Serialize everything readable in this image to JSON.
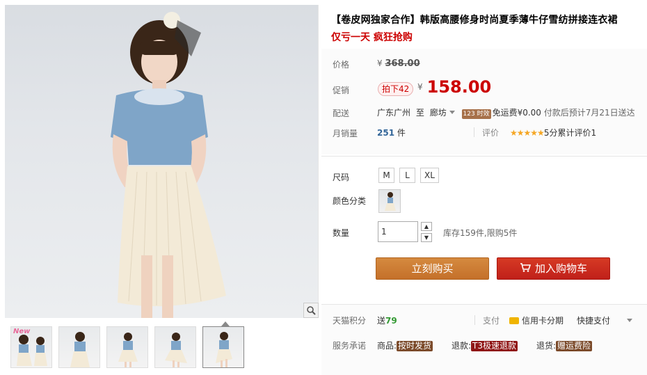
{
  "product": {
    "title": "【卷皮网独家合作】韩版高腰修身时尚夏季薄牛仔雪纺拼接连衣裙",
    "subtitle": "仅亏一天 疯狂抢购"
  },
  "price": {
    "label": "价格",
    "original_currency": "¥",
    "original": "368.00",
    "promo_label": "促销",
    "promo_tag": "拍下42",
    "promo_currency": "¥",
    "promo": "158.00"
  },
  "shipping": {
    "label": "配送",
    "from": "广东广州",
    "to_word": "至",
    "to": "廊坊",
    "badge": "123 时效",
    "free_text": "免运费¥0.00",
    "eta": "付款后预计7月21日送达"
  },
  "sales": {
    "label": "月销量",
    "count": "251",
    "unit": "件",
    "review_label": "评价",
    "stars": "★★★★★",
    "review_text": "5分累计评价1"
  },
  "size": {
    "label": "尺码",
    "options": [
      "M",
      "L",
      "XL"
    ]
  },
  "color": {
    "label": "颜色分类"
  },
  "quantity": {
    "label": "数量",
    "value": "1",
    "up": "▲",
    "down": "▼",
    "stock_text": "库存159件,限购5件"
  },
  "actions": {
    "buy_now": "立刻购买",
    "add_cart": "加入购物车"
  },
  "points": {
    "label": "天猫积分",
    "text_prefix": "送",
    "value": "79"
  },
  "payment": {
    "label": "支付",
    "credit": "信用卡分期",
    "quick": "快捷支付"
  },
  "service": {
    "label": "服务承诺",
    "goods_label": "商品:",
    "goods_tag": "按时发货",
    "refund_label": "退款:",
    "refund_tag": "T3极速退款",
    "return_label": "退货:",
    "return_tag": "赠运费险"
  },
  "colors": {
    "price_red": "#cc0000",
    "buy_orange": "#c4702a",
    "cart_red": "#c0201a"
  },
  "thumbnails": [
    {
      "caption": "New"
    },
    {
      "caption": ""
    },
    {
      "caption": ""
    },
    {
      "caption": ""
    },
    {
      "caption": ""
    }
  ]
}
